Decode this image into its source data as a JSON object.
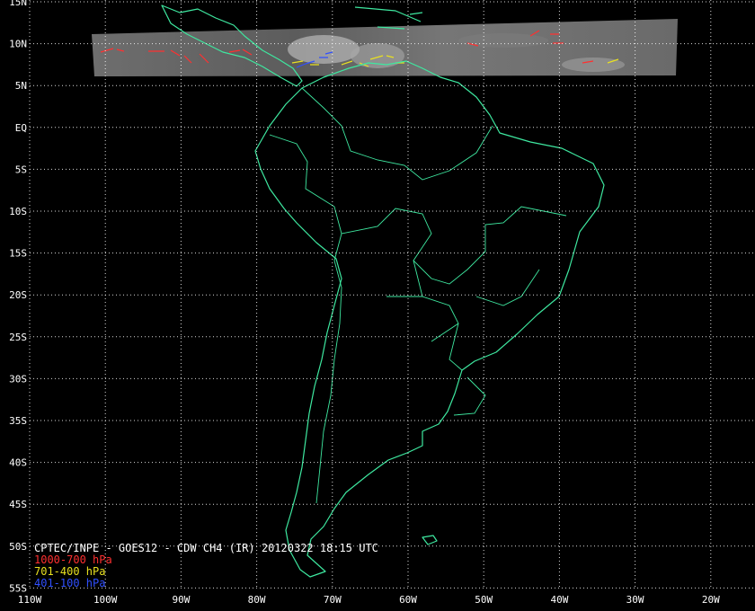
{
  "title": "CPTEC/INPE - GOES12 - CDW CH4 (IR) 20120322 18:15 UTC",
  "legend": [
    {
      "label": "1000-700 hPa",
      "color": "#ff3030"
    },
    {
      "label": "701-400 hPa",
      "color": "#e8e020"
    },
    {
      "label": "401-100 hPa",
      "color": "#3050ff"
    }
  ],
  "colors": {
    "background": "#000000",
    "coast": "#3ee8a0",
    "grid": "#ffffff",
    "imagery": "#8a8a8a"
  },
  "lat_labels": [
    "15N",
    "10N",
    "5N",
    "EQ",
    "5S",
    "10S",
    "15S",
    "20S",
    "25S",
    "30S",
    "35S",
    "40S",
    "45S",
    "50S",
    "55S"
  ],
  "lon_labels": [
    "110W",
    "100W",
    "90W",
    "80W",
    "70W",
    "60W",
    "50W",
    "40W",
    "30W",
    "20W"
  ]
}
